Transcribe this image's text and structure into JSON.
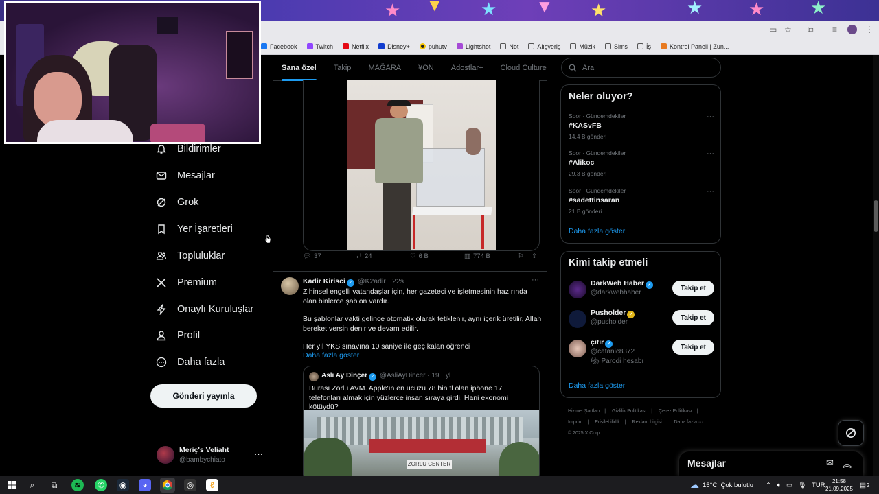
{
  "browser": {
    "bookmarks": [
      "Facebook",
      "Twitch",
      "Netflix",
      "Disney+",
      "puhutv",
      "Lightshot",
      "Not",
      "Alışveriş",
      "Müzik",
      "Sims",
      "İş",
      "Kontrol Paneli | Zun..."
    ]
  },
  "sidebar": {
    "items": [
      {
        "label": "Bildirimler",
        "icon": "bell-icon"
      },
      {
        "label": "Mesajlar",
        "icon": "mail-icon"
      },
      {
        "label": "Grok",
        "icon": "grok-icon"
      },
      {
        "label": "Yer İşaretleri",
        "icon": "bookmark-icon"
      },
      {
        "label": "Topluluklar",
        "icon": "communities-icon"
      },
      {
        "label": "Premium",
        "icon": "x-logo-icon"
      },
      {
        "label": "Onaylı Kuruluşlar",
        "icon": "lightning-icon"
      },
      {
        "label": "Profil",
        "icon": "person-icon"
      },
      {
        "label": "Daha fazla",
        "icon": "more-circle-icon"
      }
    ],
    "post_button": "Gönderi yayınla",
    "account": {
      "name": "Meriç's Veliaht",
      "handle": "@bambychiato",
      "more": "···"
    }
  },
  "main": {
    "tabs": [
      "Sana özel",
      "Takip",
      "MAĞARA",
      "¥ON",
      "Adostlar+",
      "Cloud Culture"
    ],
    "tweet1_actions": {
      "replies": "37",
      "retweets": "24",
      "likes": "6 B",
      "views": "774 B"
    },
    "tweet2": {
      "name": "Kadir Kirisci",
      "handle": "@K2adir",
      "time": "· 22s",
      "more": "···",
      "text1": "Zihinsel engelli vatandaşlar için, her gazeteci ve işletmesinin hazırında olan binlerce şablon vardır.",
      "text2": "Bu şablonlar vakti gelince otomatik olarak tetiklenir, aynı içerik üretilir, Allah bereket versin denir ve devam edilir.",
      "text3": "Her yıl YKS sınavına 10 saniye ile geç kalan öğrenci",
      "show_more": "Daha fazla göster",
      "quote": {
        "name": "Aslı Ay Dinçer",
        "handle": "@AsliAyDincer",
        "time": "· 19 Eyl",
        "text": "Burası Zorlu AVM. Apple'ın en ucuzu 78 bin tl olan iphone 17 telefonları almak için yüzlerce insan sıraya girdi. Hani ekonomi kötüydü?",
        "sign": "ZORLU CENTER"
      }
    }
  },
  "right": {
    "search_placeholder": "Ara",
    "trends_title": "Neler oluyor?",
    "trends": [
      {
        "category": "Spor · Gündemdekiler",
        "tag": "#KASvFB",
        "count": "14,4 B gönderi"
      },
      {
        "category": "Spor · Gündemdekiler",
        "tag": "#Alikoc",
        "count": "29,3 B gönderi"
      },
      {
        "category": "Spor · Gündemdekiler",
        "tag": "#sadettinsaran",
        "count": "21 B gönderi"
      }
    ],
    "trends_more": "Daha fazla göster",
    "who_title": "Kimi takip etmeli",
    "who": [
      {
        "name": "DarkWeb Haber",
        "handle": "@darkwebhaber",
        "badge": "blue",
        "extra": ""
      },
      {
        "name": "Pusholder",
        "handle": "@pusholder",
        "badge": "gold",
        "extra": ""
      },
      {
        "name": "çıtır",
        "handle": "@catanic8372",
        "badge": "blue",
        "extra": "Parodi hesabı"
      }
    ],
    "follow_label": "Takip et",
    "who_more": "Daha fazla göster",
    "footer": [
      "Hizmet Şartları",
      "|",
      "Gizlilik Politikası",
      "|",
      "Çerez Politikası",
      "|",
      "Imprint",
      "|",
      "Erişilebilirlik",
      "|",
      "Reklam bilgisi",
      "|",
      "Daha fazla ···",
      "© 2025 X Corp."
    ]
  },
  "messages_drawer": {
    "title": "Mesajlar"
  },
  "taskbar": {
    "weather": "15°C",
    "weather_text": "Çok bulutlu",
    "lang": "TUR",
    "time": "21:58",
    "date": "21.09.2025",
    "notif_count": "2"
  }
}
